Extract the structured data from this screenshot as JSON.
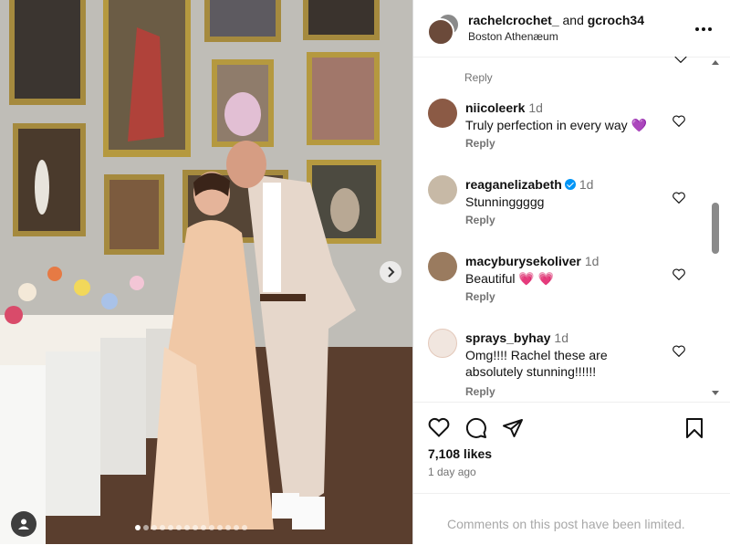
{
  "post": {
    "accounts_main": "rachelcrochet_",
    "accounts_joiner": "and",
    "accounts_second": "gcroch34",
    "location": "Boston Athenæum",
    "likes": "7,108 likes",
    "posted": "1 day ago",
    "comments_limited": "Comments on this post have been limited."
  },
  "comments": [
    {
      "username": "niicoleerk",
      "time": "1d",
      "text": "Truly perfection in every way 💜",
      "reply": "Reply",
      "avatar_color": "#8b5a45",
      "verified": false
    },
    {
      "username": "reaganelizabeth",
      "time": "1d",
      "text": "Stunninggggg",
      "reply": "Reply",
      "avatar_color": "#c7b9a6",
      "verified": true
    },
    {
      "username": "macyburysekoliver",
      "time": "1d",
      "text": "Beautiful 💗 💗",
      "reply": "Reply",
      "avatar_color": "#9a7b5f",
      "verified": false
    },
    {
      "username": "sprays_byhay",
      "time": "1d",
      "text": "Omg!!!! Rachel these are absolutely stunning!!!!!!",
      "reply": "Reply",
      "avatar_color": "#f1e6df",
      "verified": false
    }
  ],
  "top_partial_reply": "Reply",
  "icons": [
    "heart-icon",
    "comment-icon",
    "share-icon",
    "bookmark-icon",
    "more-icon",
    "chevron-right-icon",
    "user-tag-icon"
  ],
  "colors": {
    "muted": "#737373",
    "verified": "#0095f6",
    "placeholder": "#a8a8a8"
  },
  "carousel": {
    "slides": 14,
    "active": 0
  }
}
